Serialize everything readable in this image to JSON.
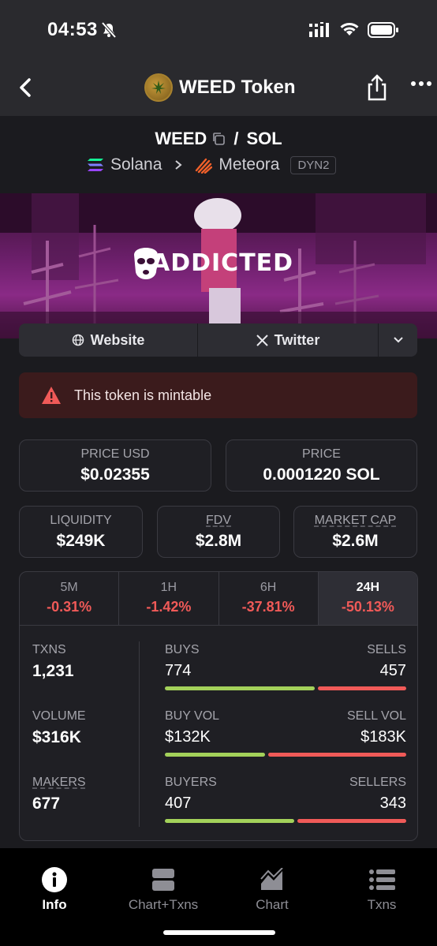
{
  "status": {
    "time": "04:53"
  },
  "nav": {
    "title": "WEED Token"
  },
  "pair": {
    "base": "WEED",
    "separator": "/",
    "quote": "SOL",
    "chain": "Solana",
    "dex": "Meteora",
    "badge": "DYN2"
  },
  "banner": {
    "text": "ADDICTED"
  },
  "links": {
    "website": "Website",
    "twitter": "Twitter"
  },
  "warning": {
    "text": "This token is mintable"
  },
  "prices": {
    "price_usd_label": "PRICE USD",
    "price_usd": "$0.02355",
    "price_label": "PRICE",
    "price": "0.0001220 SOL"
  },
  "metrics": {
    "liquidity_label": "LIQUIDITY",
    "liquidity": "$249K",
    "fdv_label": "FDV",
    "fdv": "$2.8M",
    "mcap_label": "MARKET CAP",
    "mcap": "$2.6M"
  },
  "timeframes": [
    {
      "label": "5M",
      "change": "-0.31%"
    },
    {
      "label": "1H",
      "change": "-1.42%"
    },
    {
      "label": "6H",
      "change": "-37.81%"
    },
    {
      "label": "24H",
      "change": "-50.13%"
    }
  ],
  "stats": {
    "txns_label": "TXNS",
    "txns": "1,231",
    "volume_label": "VOLUME",
    "volume": "$316K",
    "makers_label": "MAKERS",
    "makers": "677",
    "buys_label": "BUYS",
    "buys": "774",
    "sells_label": "SELLS",
    "sells": "457",
    "buyvol_label": "BUY VOL",
    "buyvol": "$132K",
    "sellvol_label": "SELL VOL",
    "sellvol": "$183K",
    "buyers_label": "BUYERS",
    "buyers": "407",
    "sellers_label": "SELLERS",
    "sellers": "343",
    "buy_ratio": 0.629,
    "buyvol_ratio": 0.419,
    "buyers_ratio": 0.543
  },
  "tabbar": {
    "info": "Info",
    "chart_txns": "Chart+Txns",
    "chart": "Chart",
    "txns": "Txns"
  },
  "colors": {
    "positive": "#a3d15a",
    "negative": "#f05a58",
    "background": "#1b1b1f"
  }
}
